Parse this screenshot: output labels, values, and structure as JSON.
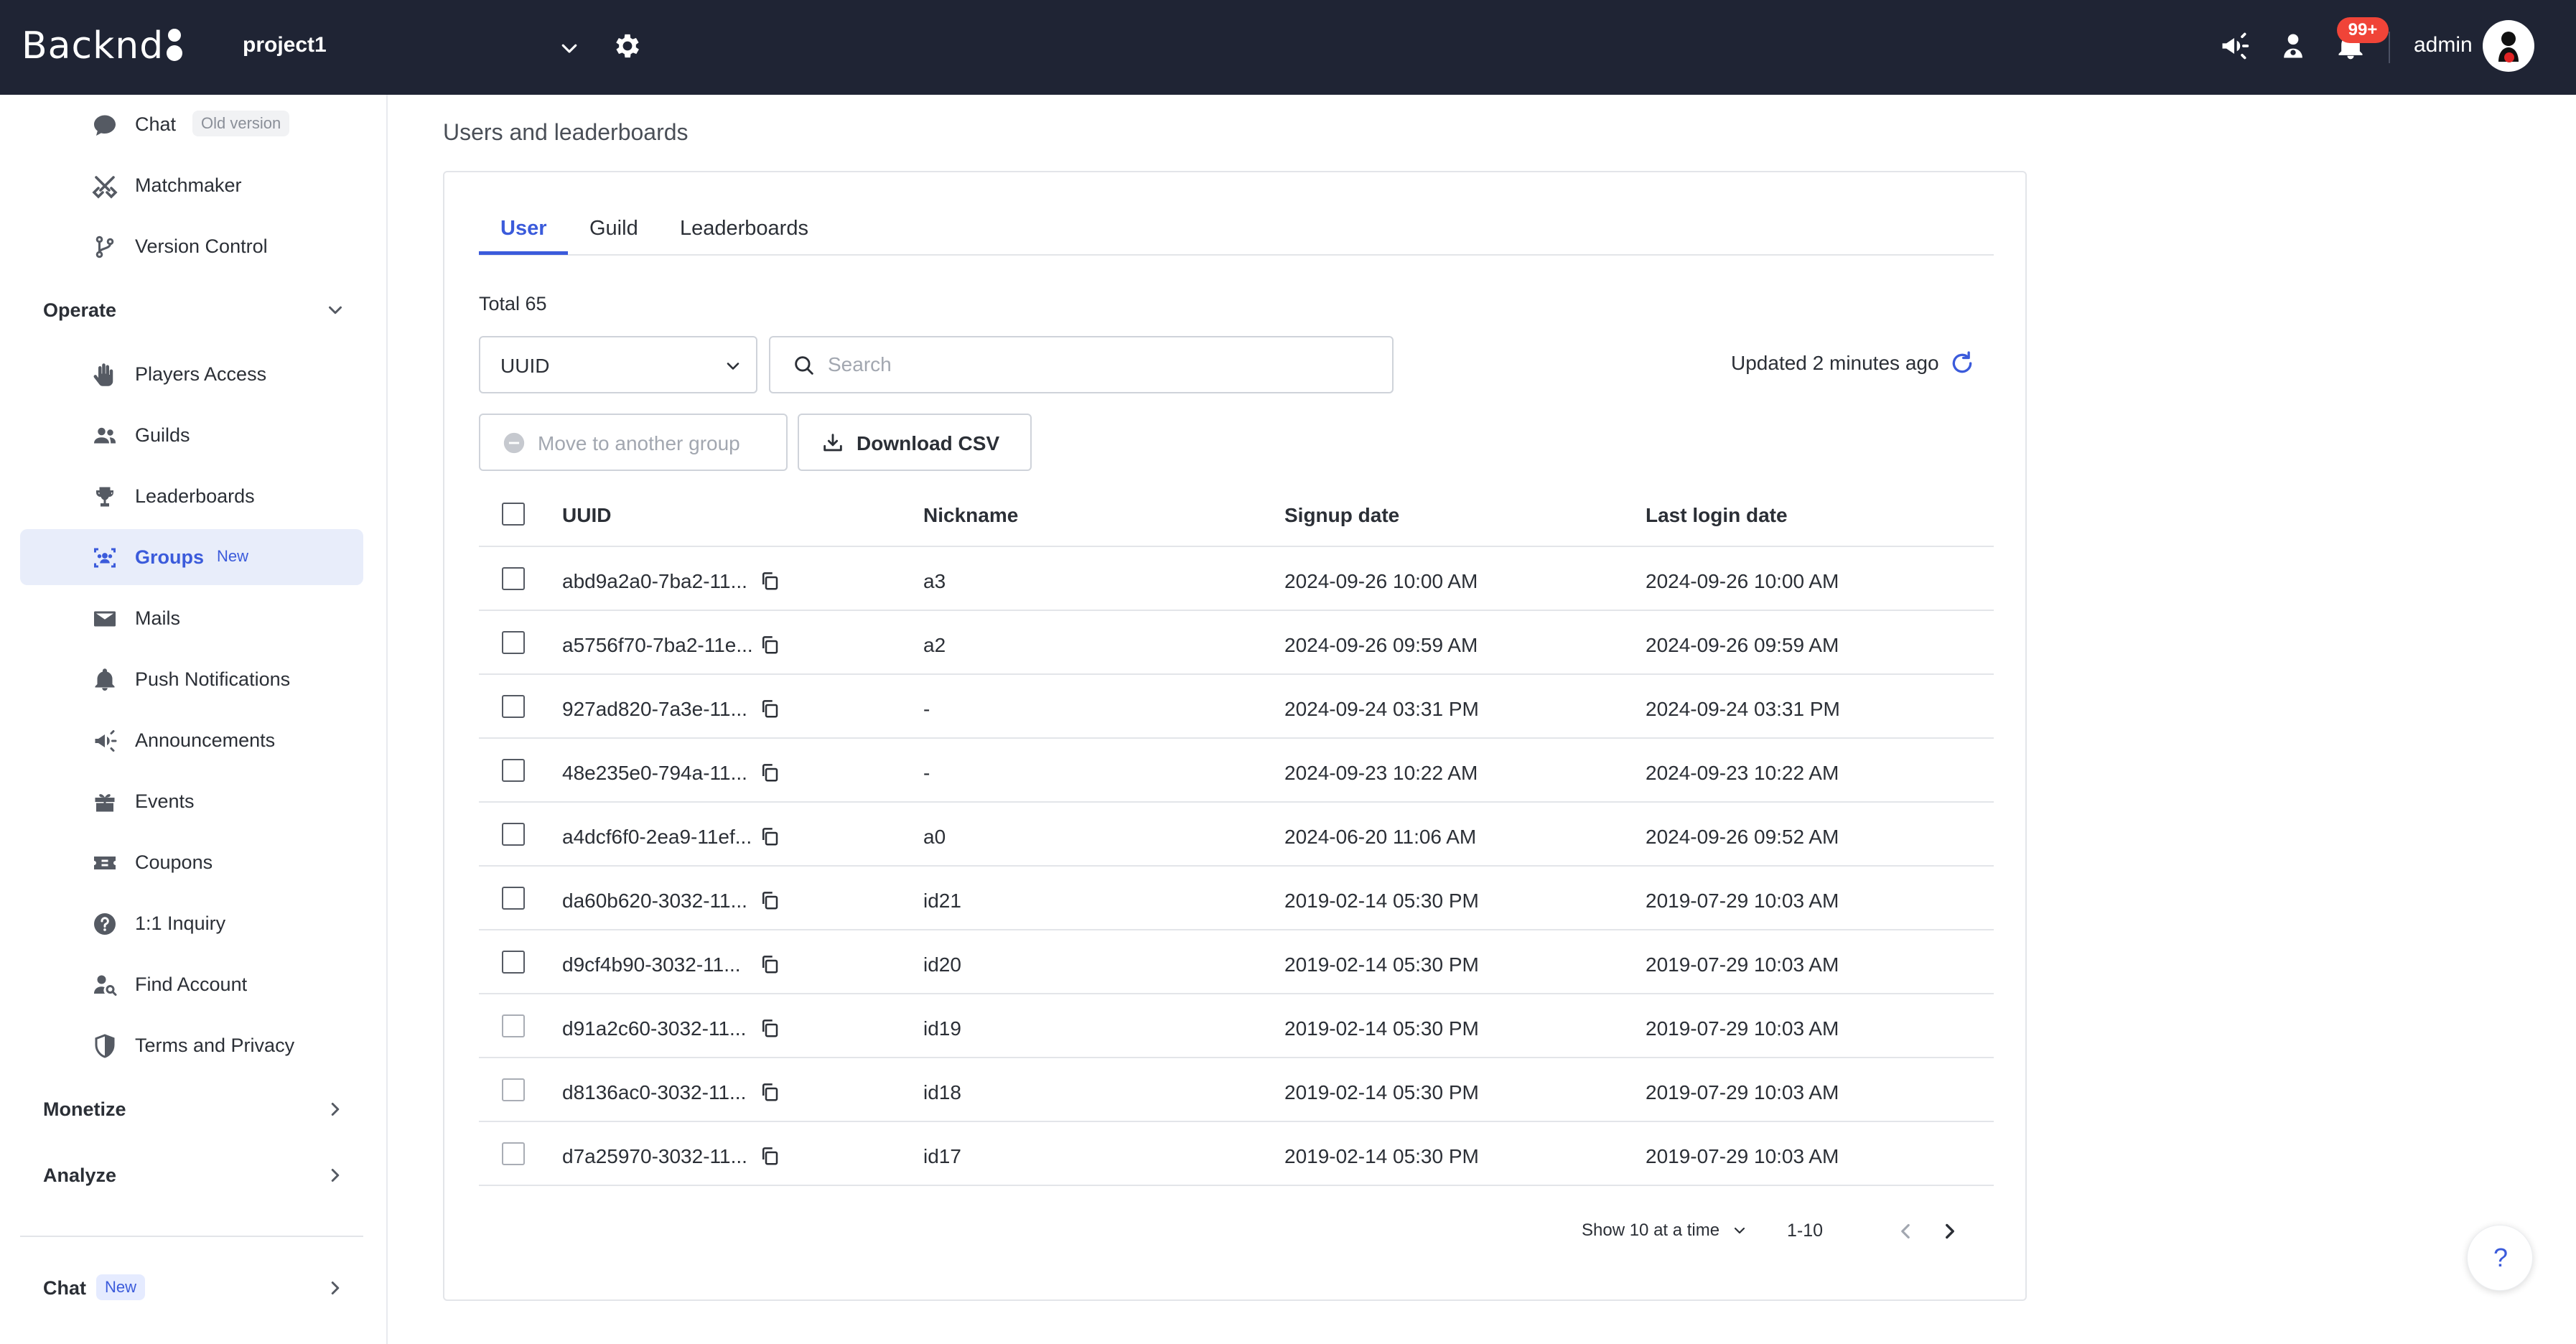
{
  "topbar": {
    "logo_text": "Backnd",
    "project": "project1",
    "notification_badge": "99+",
    "user": "admin"
  },
  "sidebar": {
    "items_top": [
      {
        "label": "Chat",
        "tag": "Old version",
        "icon": "chat-bubble-icon"
      },
      {
        "label": "Matchmaker",
        "icon": "crossed-swords-icon"
      },
      {
        "label": "Version Control",
        "icon": "branch-icon"
      }
    ],
    "operate_label": "Operate",
    "operate_items": [
      {
        "label": "Players Access",
        "icon": "hand-icon"
      },
      {
        "label": "Guilds",
        "icon": "people-icon"
      },
      {
        "label": "Leaderboards",
        "icon": "trophy-icon"
      },
      {
        "label": "Groups",
        "tag": "New",
        "icon": "group-icon"
      },
      {
        "label": "Mails",
        "icon": "mail-icon"
      },
      {
        "label": "Push Notifications",
        "icon": "bell-icon"
      },
      {
        "label": "Announcements",
        "icon": "megaphone-icon"
      },
      {
        "label": "Events",
        "icon": "gift-icon"
      },
      {
        "label": "Coupons",
        "icon": "ticket-icon"
      },
      {
        "label": "1:1 Inquiry",
        "icon": "question-icon"
      },
      {
        "label": "Find Account",
        "icon": "person-search-icon"
      },
      {
        "label": "Terms and Privacy",
        "icon": "shield-icon"
      }
    ],
    "monetize_label": "Monetize",
    "analyze_label": "Analyze",
    "chat_label": "Chat",
    "chat_tag": "New"
  },
  "main": {
    "page_title": "Users and leaderboards",
    "tabs": [
      "User",
      "Guild",
      "Leaderboards"
    ],
    "total": "Total 65",
    "filter_select": "UUID",
    "search_placeholder": "Search",
    "updated": "Updated 2 minutes ago",
    "move_button": "Move to another group",
    "csv_button": "Download CSV",
    "columns": [
      "UUID",
      "Nickname",
      "Signup date",
      "Last login date"
    ],
    "rows": [
      {
        "uuid": "abd9a2a0-7ba2-11...",
        "nickname": "a3",
        "signup": "2024-09-26 10:00 AM",
        "last_login": "2024-09-26 10:00 AM"
      },
      {
        "uuid": "a5756f70-7ba2-11e...",
        "nickname": "a2",
        "signup": "2024-09-26 09:59 AM",
        "last_login": "2024-09-26 09:59 AM"
      },
      {
        "uuid": "927ad820-7a3e-11...",
        "nickname": "-",
        "signup": "2024-09-24 03:31 PM",
        "last_login": "2024-09-24 03:31 PM"
      },
      {
        "uuid": "48e235e0-794a-11...",
        "nickname": "-",
        "signup": "2024-09-23 10:22 AM",
        "last_login": "2024-09-23 10:22 AM"
      },
      {
        "uuid": "a4dcf6f0-2ea9-11ef...",
        "nickname": "a0",
        "signup": "2024-06-20 11:06 AM",
        "last_login": "2024-09-26 09:52 AM"
      },
      {
        "uuid": "da60b620-3032-11...",
        "nickname": "id21",
        "signup": "2019-02-14 05:30 PM",
        "last_login": "2019-07-29 10:03 AM"
      },
      {
        "uuid": "d9cf4b90-3032-11...",
        "nickname": "id20",
        "signup": "2019-02-14 05:30 PM",
        "last_login": "2019-07-29 10:03 AM"
      },
      {
        "uuid": "d91a2c60-3032-11...",
        "nickname": "id19",
        "signup": "2019-02-14 05:30 PM",
        "last_login": "2019-07-29 10:03 AM"
      },
      {
        "uuid": "d8136ac0-3032-11...",
        "nickname": "id18",
        "signup": "2019-02-14 05:30 PM",
        "last_login": "2019-07-29 10:03 AM"
      },
      {
        "uuid": "d7a25970-3032-11...",
        "nickname": "id17",
        "signup": "2019-02-14 05:30 PM",
        "last_login": "2019-07-29 10:03 AM"
      }
    ],
    "page_size": "Show 10 at a time",
    "page_range": "1-10"
  },
  "help_label": "?"
}
